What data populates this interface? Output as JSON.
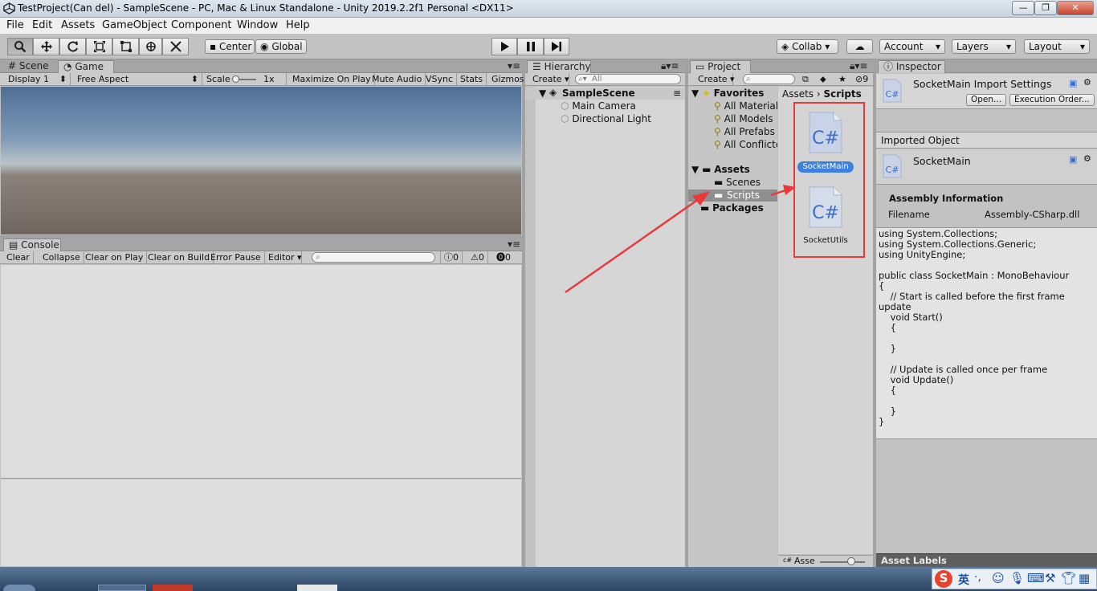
{
  "window": {
    "title": "TestProject(Can del) - SampleScene - PC, Mac & Linux Standalone - Unity 2019.2.2f1 Personal <DX11>",
    "minimize": "—",
    "maximize": "❐",
    "close": "✕"
  },
  "menu": [
    "File",
    "Edit",
    "Assets",
    "GameObject",
    "Component",
    "Window",
    "Help"
  ],
  "toolbar": {
    "pivot": "Center",
    "space": "Global",
    "collab": "Collab",
    "account": "Account",
    "layers": "Layers",
    "layout": "Layout"
  },
  "scene_game": {
    "tabs": [
      "Scene",
      "Game"
    ],
    "display": "Display 1",
    "aspect": "Free Aspect",
    "scale_label": "Scale",
    "scale_value": "1x",
    "options": [
      "Maximize On Play",
      "Mute Audio",
      "VSync",
      "Stats",
      "Gizmos"
    ]
  },
  "console": {
    "tab": "Console",
    "buttons": [
      "Clear",
      "Collapse",
      "Clear on Play",
      "Clear on Build",
      "Error Pause",
      "Editor"
    ],
    "counts": {
      "log": "0",
      "warn": "0",
      "error": "0"
    }
  },
  "hierarchy": {
    "tab": "Hierarchy",
    "create": "Create",
    "search_placeholder": "All",
    "scene": "SampleScene",
    "items": [
      "Main Camera",
      "Directional Light"
    ]
  },
  "project": {
    "tab": "Project",
    "create": "Create",
    "filter_count": "9",
    "favorites_label": "Favorites",
    "favorites": [
      "All Material",
      "All Models",
      "All Prefabs",
      "All Conflicte"
    ],
    "assets_label": "Assets",
    "asset_folders": [
      "Scenes",
      "Scripts"
    ],
    "packages_label": "Packages",
    "breadcrumb": [
      "Assets",
      "Scripts"
    ],
    "files": [
      "SocketMain",
      "SocketUtils"
    ],
    "file_icon": "C#",
    "footer_label": "Asse"
  },
  "inspector": {
    "tab": "Inspector",
    "header_title": "SocketMain Import Settings",
    "open_button": "Open...",
    "exec_order_button": "Execution Order...",
    "imported_object_label": "Imported Object",
    "object_name": "SocketMain",
    "assembly_heading": "Assembly Information",
    "filename_label": "Filename",
    "filename_value": "Assembly-CSharp.dll",
    "code": "using System.Collections;\nusing System.Collections.Generic;\nusing UnityEngine;\n\npublic class SocketMain : MonoBehaviour\n{\n    // Start is called before the first frame\nupdate\n    void Start()\n    {\n\n    }\n\n    // Update is called once per frame\n    void Update()\n    {\n\n    }\n}",
    "asset_labels": "Asset Labels"
  },
  "ime": {
    "lang": "英"
  },
  "colors": {
    "highlight": "#3d80df",
    "annotation_red": "#e83a3a",
    "panel": "#c2c2c2"
  }
}
